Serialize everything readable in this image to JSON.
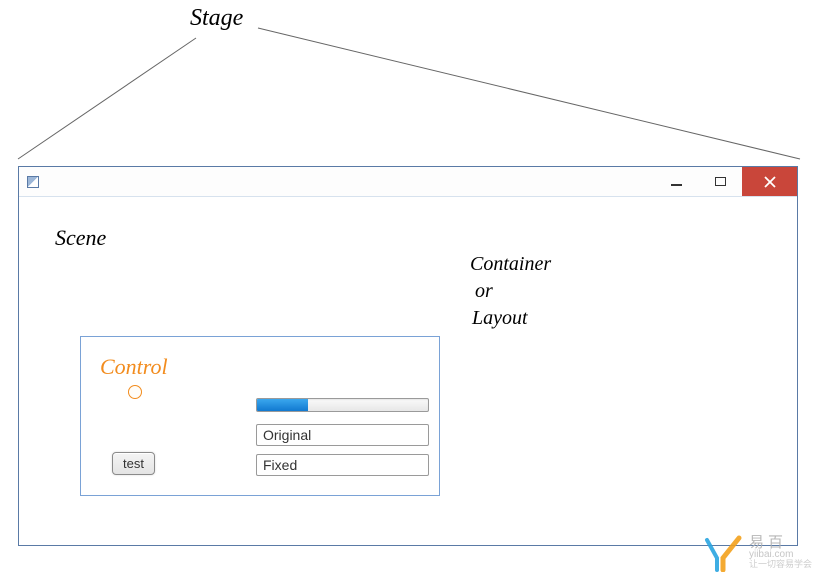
{
  "labels": {
    "stage": "Stage",
    "scene": "Scene",
    "container": "Container",
    "or": "or",
    "layout": "Layout",
    "control": "Control"
  },
  "controls": {
    "button_label": "test",
    "input1_value": "Original",
    "input2_value": "Fixed",
    "progress_percent": 30
  },
  "watermark": {
    "cn": "易百",
    "domain": "yiibai.com",
    "tag": "让一切容易学会"
  }
}
